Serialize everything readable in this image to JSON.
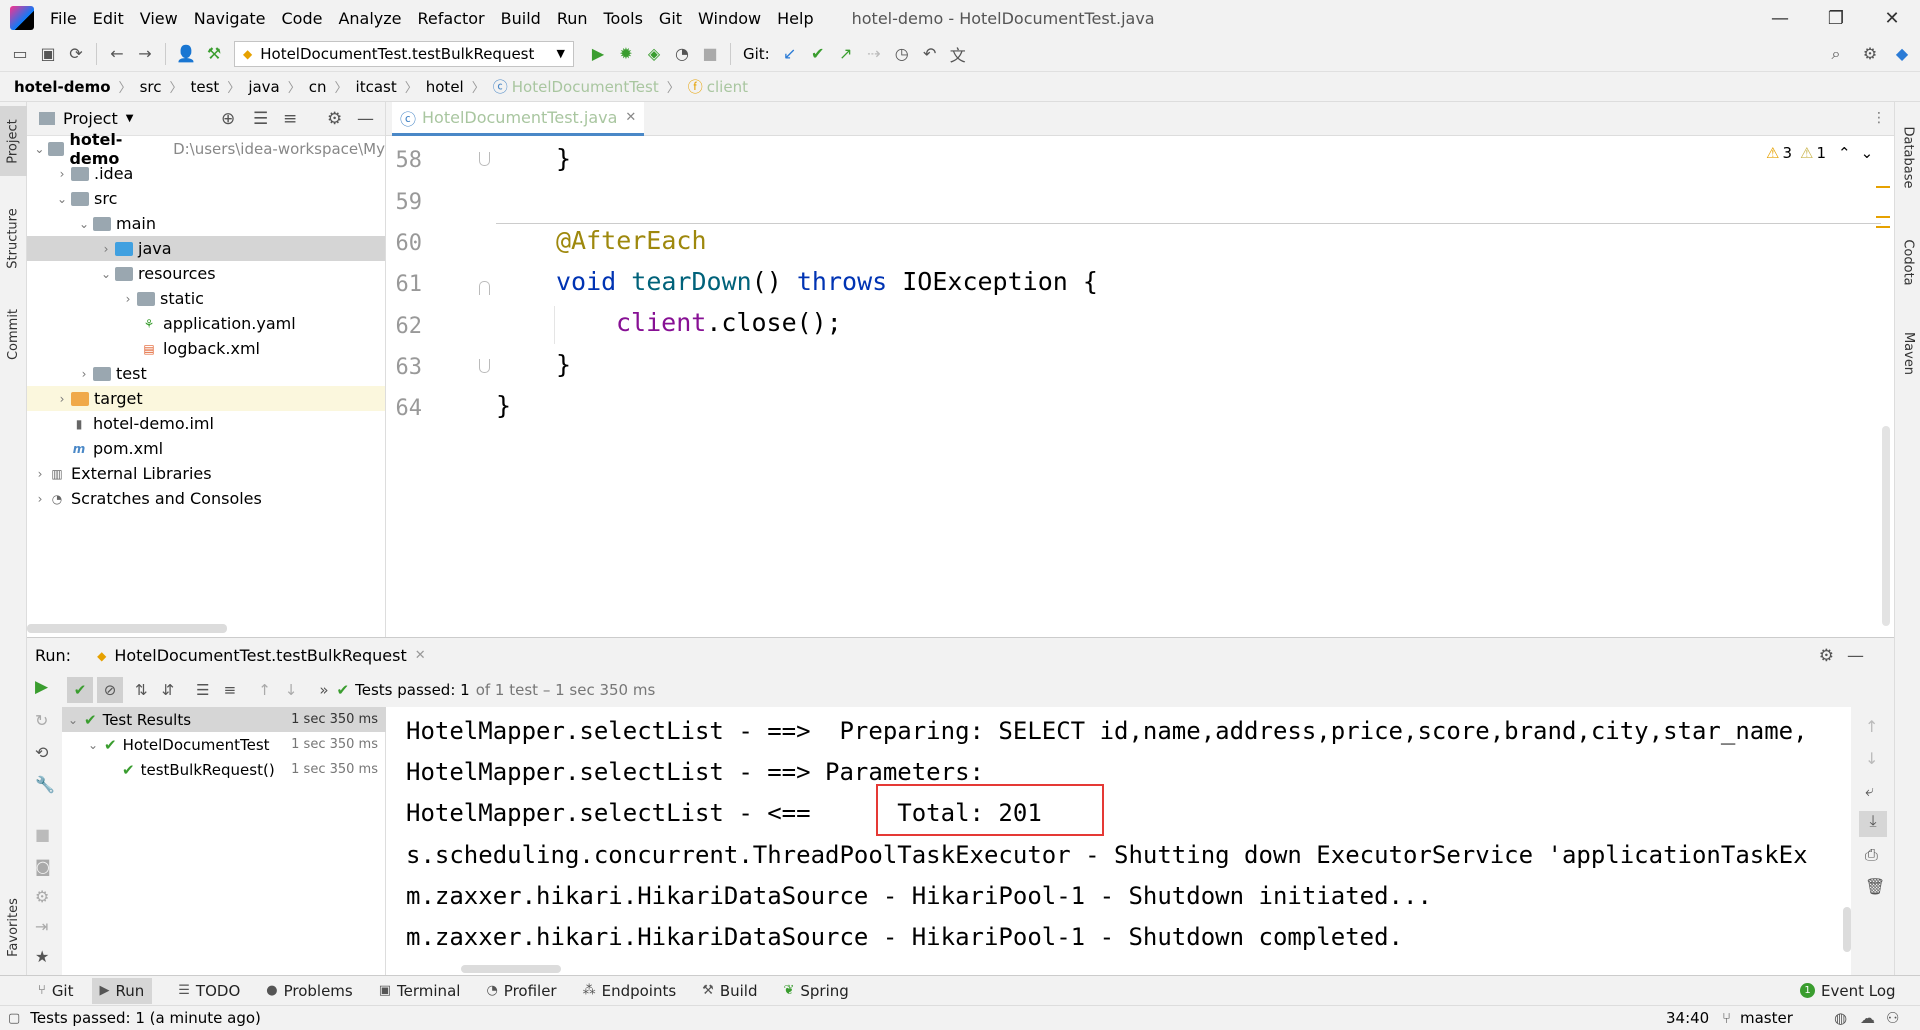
{
  "menu": [
    "File",
    "Edit",
    "View",
    "Navigate",
    "Code",
    "Analyze",
    "Refactor",
    "Build",
    "Run",
    "Tools",
    "Git",
    "Window",
    "Help"
  ],
  "window_title": "hotel-demo - HotelDocumentTest.java",
  "toolbar": {
    "run_config": "HotelDocumentTest.testBulkRequest",
    "git_label": "Git:"
  },
  "breadcrumb": [
    "hotel-demo",
    "src",
    "test",
    "java",
    "cn",
    "itcast",
    "hotel"
  ],
  "breadcrumb_class": "HotelDocumentTest",
  "breadcrumb_field": "client",
  "side_tabs": {
    "project": "Project",
    "structure": "Structure",
    "commit": "Commit",
    "favorites": "Favorites",
    "database": "Database",
    "codota": "Codota",
    "maven": "Maven"
  },
  "project": {
    "header": "Project",
    "root_name": "hotel-demo",
    "root_path": "D:\\users\\idea-workspace\\My",
    "items": [
      ".idea",
      "src",
      "main",
      "java",
      "resources",
      "static",
      "application.yaml",
      "logback.xml",
      "test",
      "target",
      "hotel-demo.iml",
      "pom.xml",
      "External Libraries",
      "Scratches and Consoles"
    ]
  },
  "editor": {
    "tab": "HotelDocumentTest.java",
    "warnings": "3",
    "weak_warnings": "1",
    "line_numbers": [
      "58",
      "59",
      "60",
      "61",
      "62",
      "63",
      "64"
    ],
    "code": {
      "l58": "}",
      "l60": "@AfterEach",
      "l61_void": "void",
      "l61_name": "tearDown",
      "l61_paren": "()",
      "l61_throws": "throws",
      "l61_exc": "IOException {",
      "l62_client": "client",
      "l62_rest": ".close();",
      "l63": "}",
      "l64": "}"
    }
  },
  "run": {
    "label": "Run:",
    "tab": "HotelDocumentTest.testBulkRequest",
    "status_bold": "Tests passed: 1",
    "status_rest": "of 1 test – 1 sec 350 ms",
    "results": [
      {
        "name": "Test Results",
        "time": "1 sec 350 ms"
      },
      {
        "name": "HotelDocumentTest",
        "time": "1 sec 350 ms"
      },
      {
        "name": "testBulkRequest()",
        "time": "1 sec 350 ms"
      }
    ],
    "console": [
      "HotelMapper.selectList - ==>  Preparing: SELECT id,name,address,price,score,brand,city,star_name,",
      "HotelMapper.selectList - ==> Parameters: ",
      "HotelMapper.selectList - <==      Total: 201",
      "s.scheduling.concurrent.ThreadPoolTaskExecutor - Shutting down ExecutorService 'applicationTaskEx",
      "m.zaxxer.hikari.HikariDataSource - HikariPool-1 - Shutdown initiated...",
      "m.zaxxer.hikari.HikariDataSource - HikariPool-1 - Shutdown completed."
    ]
  },
  "tool_windows": [
    "Git",
    "Run",
    "TODO",
    "Problems",
    "Terminal",
    "Profiler",
    "Endpoints",
    "Build",
    "Spring"
  ],
  "event_log": "Event Log",
  "status": {
    "message": "Tests passed: 1 (a minute ago)",
    "position": "34:40",
    "branch": "master"
  }
}
